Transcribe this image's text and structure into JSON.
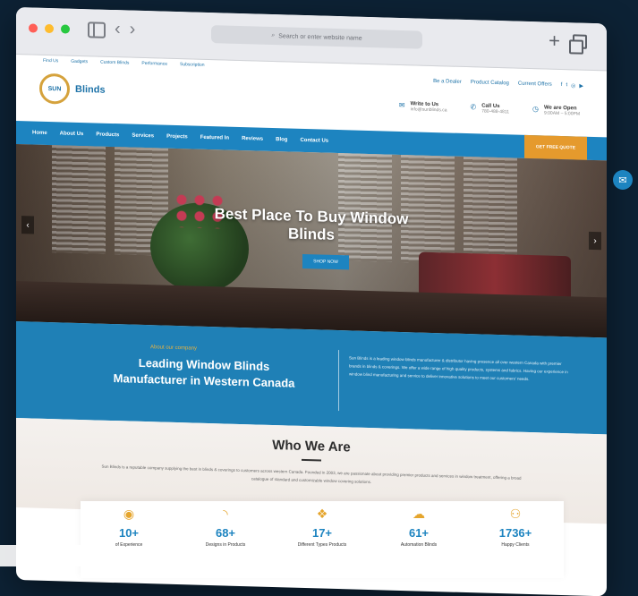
{
  "browser": {
    "url_placeholder": "Search or enter website name"
  },
  "site": {
    "topline": [
      "Find Us",
      "Gadgets",
      "Custom Blinds",
      "Performance",
      "Subscription"
    ],
    "logo_short": "SUN",
    "logo_name": "Blinds",
    "utility": [
      "Be a Dealer",
      "Product Catalog",
      "Current Offers"
    ],
    "contact": [
      {
        "label": "Write to Us",
        "value": "info@sunblinds.ca"
      },
      {
        "label": "Call Us",
        "value": "780-488-4811"
      },
      {
        "label": "We are Open",
        "value": "9:00AM – 5:00PM"
      }
    ],
    "nav": [
      "Home",
      "About Us",
      "Products",
      "Services",
      "Projects",
      "Featured In",
      "Reviews",
      "Blog",
      "Contact Us"
    ],
    "quote_button": "GET FREE QUOTE",
    "hero": {
      "title_line1": "Best Place To Buy Window",
      "title_line2": "Blinds",
      "button": "SHOP NOW"
    },
    "about": {
      "kicker": "About our company",
      "title_line1": "Leading Window Blinds",
      "title_line2": "Manufacturer in Western Canada",
      "description": "Sun Blinds is a leading window blinds manufacturer & distributor having presence all over western Canada with premier brands in blinds & coverings. We offer a wide range of high quality products, systems and fabrics. Having our experience in window blind manufacturing and service to deliver innovative solutions to meet our customers' needs."
    },
    "who": {
      "heading": "Who We Are",
      "text": "Sun Blinds is a reputable company supplying the best in blinds & coverings to customers across western Canada. Founded in 2003, we are passionate about providing premier products and services in window treatment, offering a broad catalogue of standard and customizable window covering solutions."
    },
    "stats": [
      {
        "icon": "globe-icon",
        "num": "10+",
        "label": "of Experience"
      },
      {
        "icon": "rss-icon",
        "num": "68+",
        "label": "Designs in Products"
      },
      {
        "icon": "dropbox-icon",
        "num": "17+",
        "label": "Different Types Products"
      },
      {
        "icon": "cloud-icon",
        "num": "61+",
        "label": "Automation Blinds"
      },
      {
        "icon": "users-icon",
        "num": "1736+",
        "label": "Happy Clients"
      }
    ]
  },
  "colors": {
    "primary": "#1d84c0",
    "accent": "#e59a2d",
    "background": "#0d2235"
  }
}
